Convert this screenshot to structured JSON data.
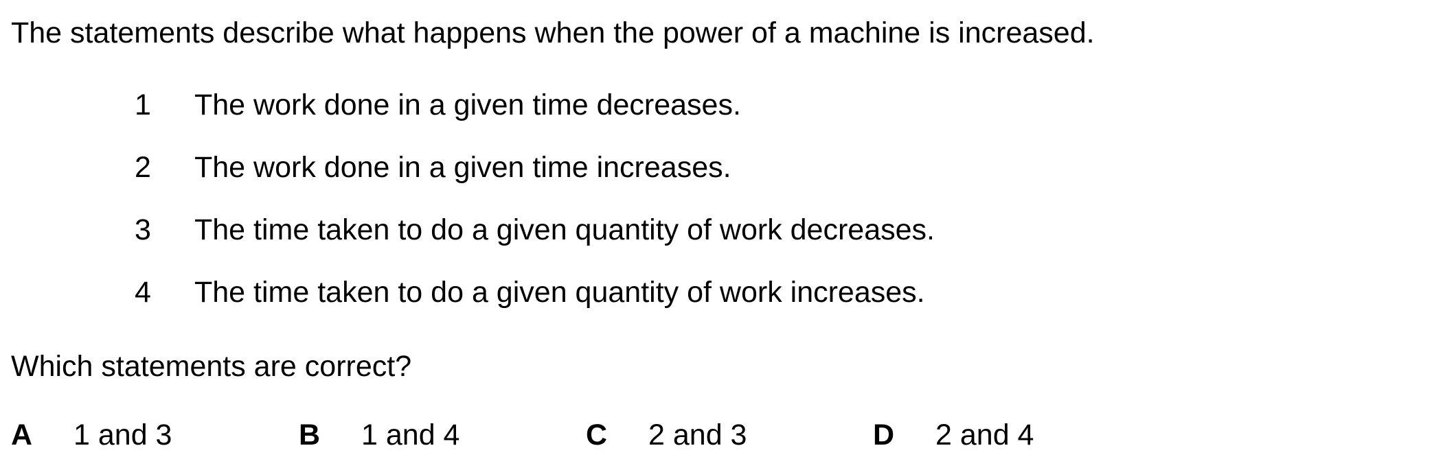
{
  "intro": "The statements describe what happens when the power of a machine is increased.",
  "statements": [
    {
      "number": "1",
      "text": "The work done in a given time decreases."
    },
    {
      "number": "2",
      "text": "The work done in a given time increases."
    },
    {
      "number": "3",
      "text": "The time taken to do a given quantity of work decreases."
    },
    {
      "number": "4",
      "text": "The time taken to do a given quantity of work increases."
    }
  ],
  "question": "Which statements are correct?",
  "options": [
    {
      "letter": "A",
      "text": "1 and 3"
    },
    {
      "letter": "B",
      "text": "1 and 4"
    },
    {
      "letter": "C",
      "text": "2 and 3"
    },
    {
      "letter": "D",
      "text": "2 and 4"
    }
  ]
}
